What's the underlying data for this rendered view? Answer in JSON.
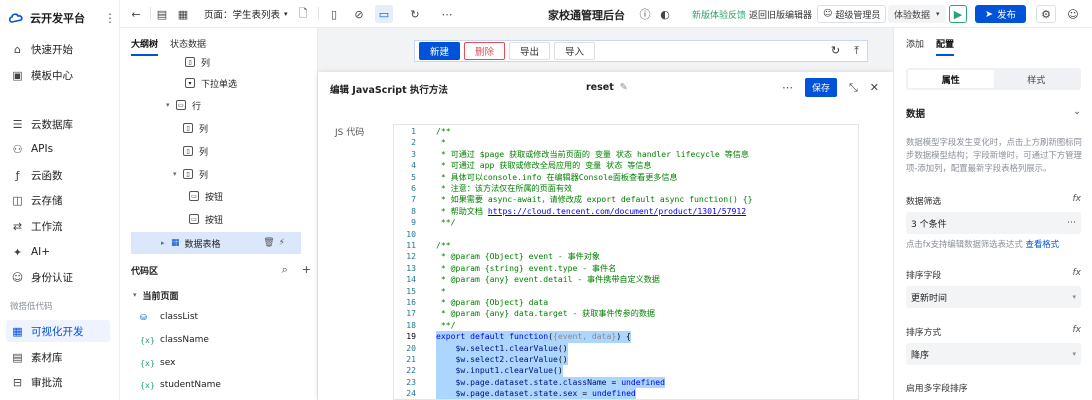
{
  "brand": {
    "title": "云开发平台",
    "more_icon": "more-vertical-icon"
  },
  "leftnav": {
    "items": [
      {
        "label": "快速开始",
        "icon": "quick-start-icon"
      },
      {
        "label": "模板中心",
        "icon": "template-icon"
      },
      {
        "label": "云数据库",
        "icon": "database-icon"
      },
      {
        "label": "APIs",
        "icon": "api-icon"
      },
      {
        "label": "云函数",
        "icon": "function-icon"
      },
      {
        "label": "云存储",
        "icon": "storage-icon"
      },
      {
        "label": "工作流",
        "icon": "workflow-icon"
      },
      {
        "label": "AI+",
        "icon": "ai-icon"
      },
      {
        "label": "身份认证",
        "icon": "auth-icon"
      },
      {
        "label": "可视化开发",
        "icon": "visual-dev-icon"
      },
      {
        "label": "素材库",
        "icon": "material-icon"
      },
      {
        "label": "审批流",
        "icon": "approval-icon"
      }
    ],
    "section_label": "微搭低代码",
    "active_label": "可视化开发"
  },
  "topbar": {
    "page_select": "页面：学生表列表",
    "app_title": "家校通管理后台",
    "feedback": "新版体验反馈",
    "back_old": "返回旧版编辑器",
    "admin": "超级管理员",
    "experience": "体验数据",
    "publish": "发布"
  },
  "tree": {
    "tabs": [
      "大纲树",
      "状态数据"
    ],
    "rows": [
      {
        "label": "列",
        "depth": 2
      },
      {
        "label": "下拉单选",
        "depth": 3
      },
      {
        "label": "行",
        "depth": 1
      },
      {
        "label": "列",
        "depth": 2
      },
      {
        "label": "列",
        "depth": 2
      },
      {
        "label": "列",
        "depth": 2
      },
      {
        "label": "按钮",
        "depth": 3
      },
      {
        "label": "按钮",
        "depth": 3
      },
      {
        "label": "数据表格",
        "depth": 1
      }
    ]
  },
  "code_area": {
    "title": "代码区",
    "group": "当前页面",
    "items": [
      {
        "label": "classList",
        "kind": "db"
      },
      {
        "label": "className",
        "kind": "var"
      },
      {
        "label": "sex",
        "kind": "var"
      },
      {
        "label": "studentName",
        "kind": "var"
      }
    ]
  },
  "canvas": {
    "buttons": [
      "新建",
      "删除",
      "导出",
      "导入"
    ]
  },
  "editor_modal": {
    "title": "编辑 JavaScript 执行方法",
    "method": "reset",
    "save": "保存",
    "js_label": "JS 代码",
    "lines": [
      "/**",
      " *",
      " * 可通过 $page 获取或修改当前页面的 变量 状态 handler lifecycle 等信息",
      " * 可通过 app 获取或修改全局应用的 变量 状态 等信息",
      " * 具体可以console.info 在编辑器Console面板查看更多信息",
      " * 注意：该方法仅在所属的页面有效",
      " * 如果需要 async-await，请修改成 export default async function() {}",
      " * 帮助文档 https://cloud.tencent.com/document/product/1301/57912",
      " **/",
      "",
      "/**",
      " * @param {Object} event - 事件对象",
      " * @param {string} event.type - 事件名",
      " * @param {any} event.detail - 事件携带自定义数据",
      " *",
      " * @param {Object} data",
      " * @param {any} data.target - 获取事件传参的数据",
      " **/",
      "export default function({event, data}) {",
      "    $w.select1.clearValue()",
      "    $w.select2.clearValue()",
      "    $w.input1.clearValue()",
      "    $w.page.dataset.state.className = undefined",
      "    $w.page.dataset.state.sex = undefined"
    ]
  },
  "rightpanel": {
    "tabs": [
      "添加",
      "配置"
    ],
    "segments": [
      "属性",
      "样式"
    ],
    "section": "数据",
    "desc": "数据模型字段发生变化时，点击上方刷新图标同步数据模型结构；字段新增时，可通过下方管理项-添加列，配置最新字段表格列展示。",
    "filter_label": "数据筛选",
    "filter_value": "3 个条件",
    "hint": "点击fx支持编辑数据筛选表达式",
    "hint_link": "查看格式",
    "sort_field_label": "排序字段",
    "sort_field_value": "更新时间",
    "sort_order_label": "排序方式",
    "sort_order_value": "降序",
    "multi_sort_label": "启用多字段排序"
  }
}
